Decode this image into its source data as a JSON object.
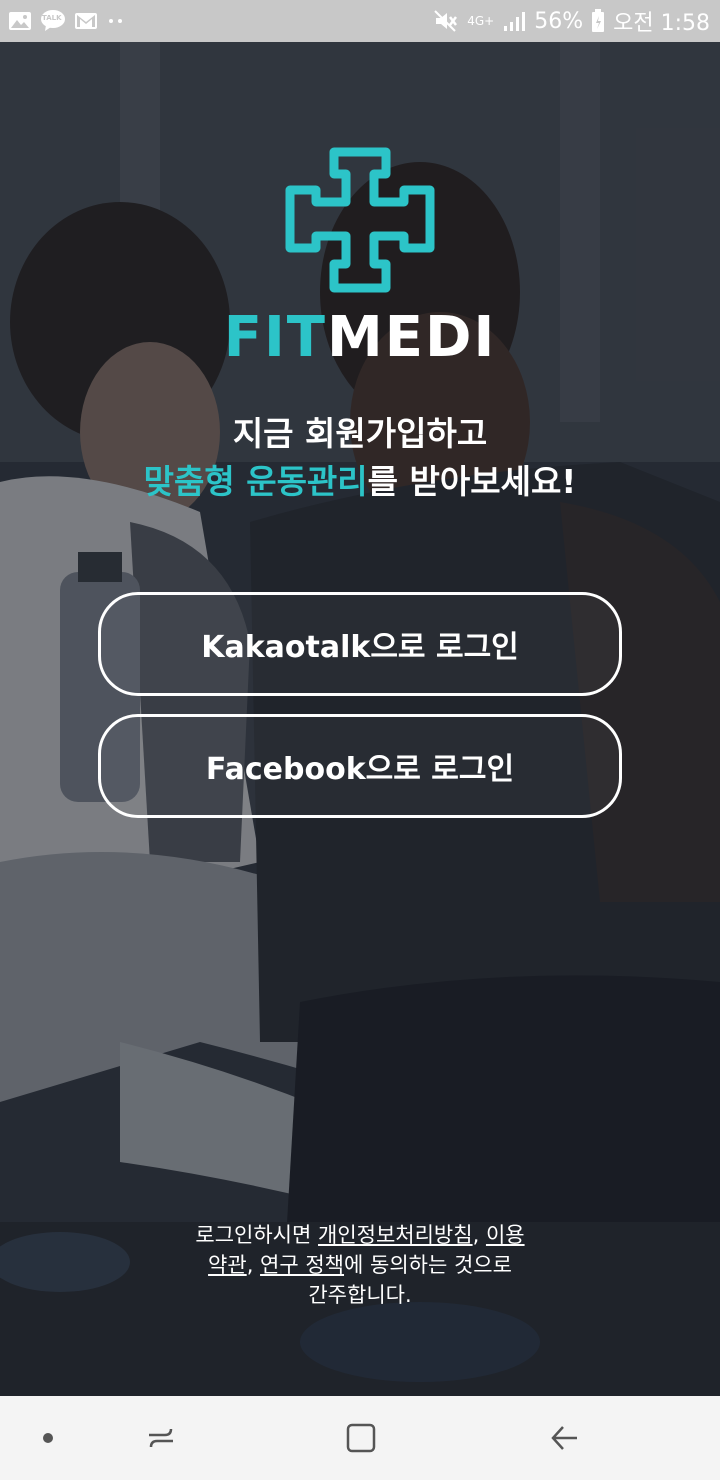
{
  "status_bar": {
    "icons_left": [
      "gallery-icon",
      "talk-icon",
      "gmail-icon",
      "more-dots-icon"
    ],
    "talk_label": "TALK",
    "network_label": "4G+",
    "battery_percent": "56%",
    "time": "오전 1:58",
    "icons_right": [
      "mute-icon",
      "signal-icon",
      "battery-icon"
    ]
  },
  "app": {
    "logo_fit": "FIT",
    "logo_medi": "MEDI",
    "headline_line1": "지금 회원가입하고",
    "headline_accent": "맞춤형 운동관리",
    "headline_rest": "를 받아보세요!",
    "accent_color": "#2cc4c8"
  },
  "buttons": {
    "kakao_label": "Kakaotalk으로 로그인",
    "facebook_label": "Facebook으로 로그인"
  },
  "terms": {
    "prefix": "로그인하시면 ",
    "privacy_link": "개인정보처리방침",
    "sep1": ", ",
    "terms_link_part1": "이용",
    "terms_link_part2": "약관",
    "sep2": ", ",
    "research_link": "연구 정책",
    "suffix_line2": "에 동의하는 것으로",
    "suffix_line3": "간주합니다."
  },
  "nav_bar": {
    "items": [
      "home-dot-icon",
      "recent-apps-icon",
      "home-square-icon",
      "back-arrow-icon"
    ]
  }
}
